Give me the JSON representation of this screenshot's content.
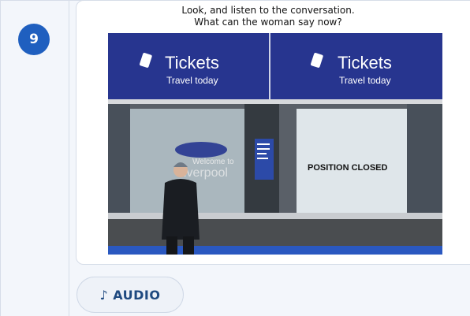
{
  "question": {
    "number": "9",
    "instruction_line1": "Look, and listen to the conversation.",
    "instruction_line2": "What can the woman say now?"
  },
  "photo": {
    "sign_left_title": "Tickets",
    "sign_left_subtitle": "Travel today",
    "sign_right_title": "Tickets",
    "sign_right_subtitle": "Travel today",
    "window_notice": "POSITION CLOSED",
    "window_welcome": "Welcome to",
    "window_city": "Liverpool"
  },
  "audio": {
    "label": "AUDIO",
    "icon": "music-note-icon"
  },
  "colors": {
    "badge": "#1f5fbf",
    "sign_blue": "#27358f",
    "audio_text": "#1f4a80"
  }
}
